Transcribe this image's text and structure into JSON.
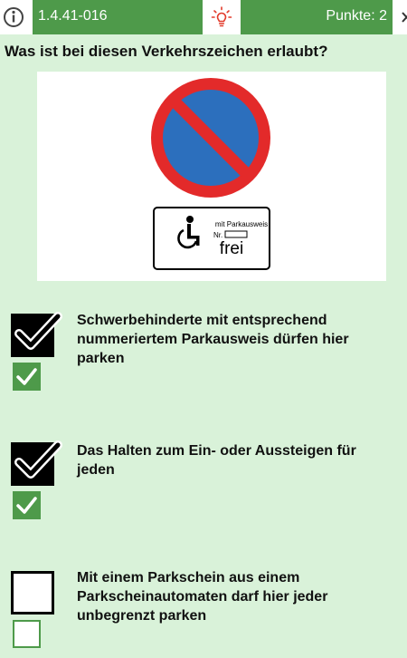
{
  "header": {
    "info_icon": "info-circle-icon",
    "question_id": "1.4.41-016",
    "hint_icon": "lightbulb-icon",
    "points_label": "Punkte: 2",
    "next_icon": "close-icon"
  },
  "question": {
    "text": "Was ist bei diesen Verkehrszeichen erlaubt?"
  },
  "sign": {
    "panel_line1": "mit Parkausweis",
    "panel_line2": "Nr.",
    "panel_line3": "frei"
  },
  "answers": [
    {
      "text": "Schwerbehinderte mit entsprechend nummeriertem Parkausweis dürfen hier parken",
      "user_checked": true,
      "solution_checked": true
    },
    {
      "text": "Das Halten zum Ein- oder Aussteigen für jeden",
      "user_checked": true,
      "solution_checked": true
    },
    {
      "text": "Mit einem Parkschein aus einem Parkscheinautomaten darf hier jeder unbegrenzt parken",
      "user_checked": false,
      "solution_checked": false
    }
  ],
  "colors": {
    "background": "#d9f2d9",
    "accent_green": "#4e9a4a",
    "sign_red": "#e32a2a",
    "sign_blue": "#2c6fbd"
  }
}
